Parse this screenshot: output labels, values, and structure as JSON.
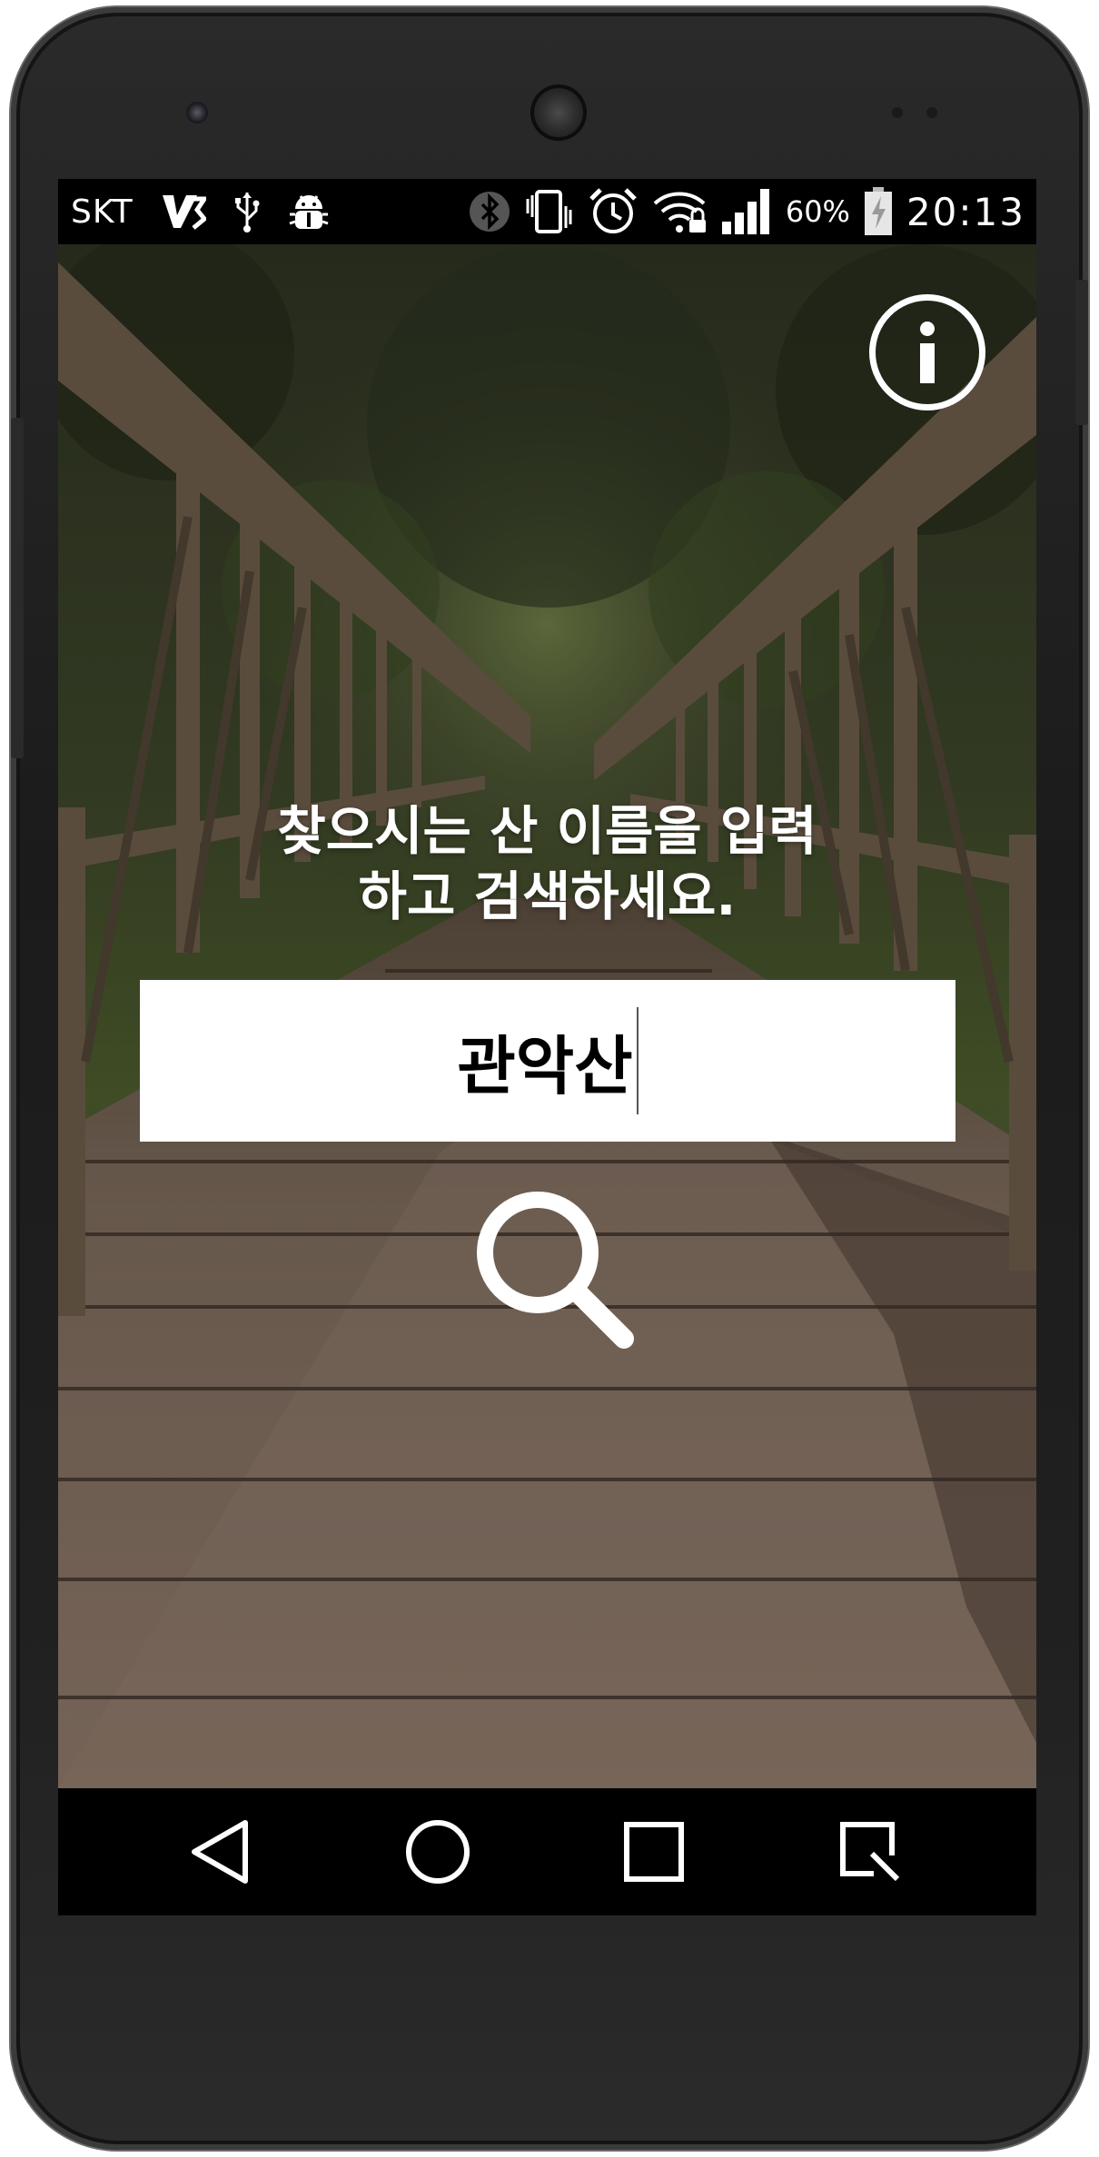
{
  "status_bar": {
    "carrier": "SKT",
    "left_icons": [
      "v3-app-icon",
      "usb-icon",
      "debug-bug-icon"
    ],
    "right_icons": [
      "bluetooth-icon",
      "vibrate-icon",
      "alarm-clock-icon",
      "wifi-locked-icon",
      "signal-icon"
    ],
    "battery_percent": "60%",
    "battery_level": 0.6,
    "time": "20:13"
  },
  "main": {
    "background": "wooden-bridge-in-forest-photo",
    "info_icon": "info-icon",
    "prompt_line1": "찾으시는 산 이름을 입력",
    "prompt_line2": "하고 검색하세요.",
    "search": {
      "value": "관악산"
    },
    "search_icon": "search-icon"
  },
  "nav_bar": {
    "buttons": [
      "back-icon",
      "home-icon",
      "recents-icon",
      "screenshot-icon"
    ]
  },
  "colors": {
    "accent": "#ffffff",
    "bars": "#000000"
  }
}
